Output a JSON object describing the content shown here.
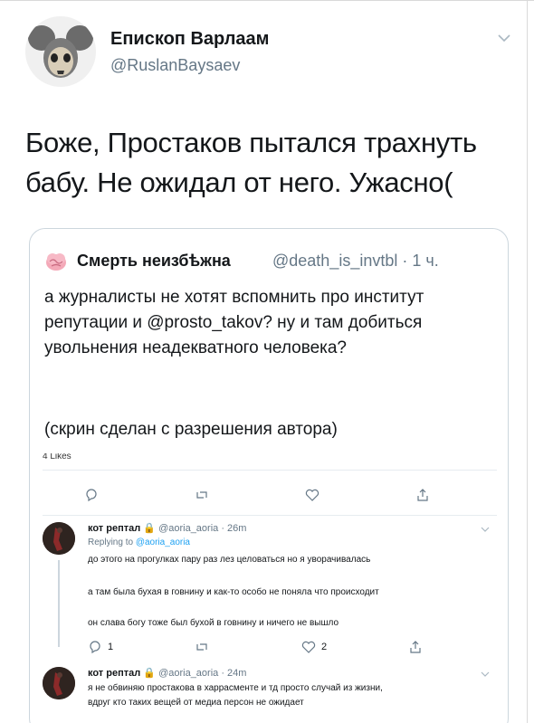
{
  "tweet": {
    "author_name": "Епископ Варлаам",
    "author_handle": "@RuslanBaysaev",
    "text": "Боже, Простаков пытался трахнуть бабу. Не ожидал от него. Ужасно("
  },
  "quoted": {
    "author_name": "Смерть неизбѣжна",
    "meta": "@death_is_invtbl · 1 ч.",
    "text": "а журналисты не хотят вспомнить про институт репутации и @prosto_takov? ну и там добиться увольнения неадекватного человека?",
    "text2": "(скрин сделан с разрешения автора)",
    "likes_partial": "4 Likes",
    "actions": {
      "reply_icon": "reply-icon",
      "retweet_icon": "retweet-icon",
      "like_icon": "heart-icon",
      "share_icon": "share-icon"
    },
    "replies": [
      {
        "name": "кот рептал",
        "meta": "@aoria_aoria · 26m",
        "replying_prefix": "Replying to",
        "replying_to": "@aoria_aoria",
        "lines": [
          "до этого на прогулках пару раз лез целоваться но я уворачивалась",
          "а там была бухая в говнину и как-то особо не поняла что происходит",
          "он слава богу тоже был бухой в говнину и ничего не вышло"
        ],
        "reply_count": "1",
        "like_count": "2"
      },
      {
        "name": "кот рептал",
        "meta": "@aoria_aoria · 24m",
        "lines": [
          "я не обвиняю простакова в харрасменте и тд просто случай из жизни,",
          "вдруг кто таких вещей от медиа персон не ожидает"
        ]
      }
    ]
  },
  "colors": {
    "text": "#14171a",
    "secondary": "#657786",
    "link": "#1da1f2",
    "border": "#ccd6dd"
  }
}
